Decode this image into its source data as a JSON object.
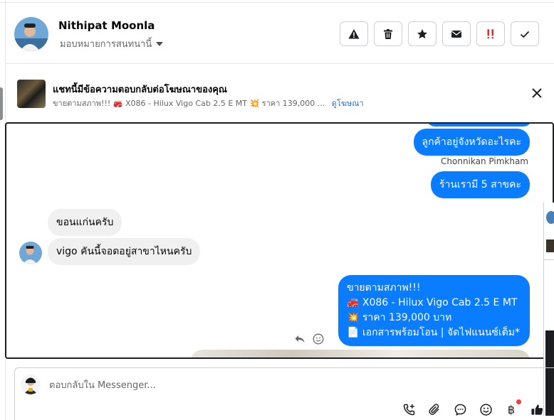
{
  "header": {
    "user_name": "Nithipat Moonla",
    "assign_label": "มอบหมายการสนทนานี้",
    "actions": [
      {
        "icon": "warning-icon",
        "name": "report-button"
      },
      {
        "icon": "trash-icon",
        "name": "delete-button"
      },
      {
        "icon": "star-icon",
        "name": "star-button"
      },
      {
        "icon": "envelope-icon",
        "name": "mark-unread-button"
      },
      {
        "icon": "follow-up-icon",
        "name": "follow-up-button"
      },
      {
        "icon": "checkmark-icon",
        "name": "mark-done-button"
      }
    ]
  },
  "ad_banner": {
    "title": "แชทนี้มีข้อความตอบกลับต่อโฆษณาของคุณ",
    "subtitle": "ขายตามสภาพ!!! 🚒 X086 - Hilux Vigo Cab 2.5 E MT 💥 ราคา 139,000 ...",
    "link": "ดูโฆษณา"
  },
  "messages": [
    {
      "direction": "out",
      "text": "ลูกค้าอยู่จังหวัดอะไรคะ",
      "sender": "Chonnikan Pimkham"
    },
    {
      "direction": "out",
      "text": "ร้านเรามี 5 สาขคะ"
    },
    {
      "direction": "in",
      "text": "ขอนแก่นครับ"
    },
    {
      "direction": "in",
      "text": "vigo คันนี้จอดอยู่สาขาไหนครับ"
    },
    {
      "direction": "out",
      "lines": [
        "ขายตามสภาพ!!!",
        "🚒 X086 - Hilux Vigo Cab 2.5 E MT",
        "💥 ราคา 139,000 บาท",
        "📄 เอกสารพร้อมโอน | จัดไฟแนนซ์เต็ม*"
      ]
    }
  ],
  "composer": {
    "placeholder": "ตอบกลับใน Messenger...",
    "tools": [
      "call-icon",
      "paperclip-icon",
      "saved-reply-icon",
      "emoji-icon",
      "baht-icon",
      "thumbs-up-icon"
    ],
    "baht_symbol": "฿"
  },
  "colors": {
    "outgoing_bubble": "#0a7cff",
    "incoming_bubble": "#f0f0f0",
    "link": "#216fdb",
    "alert_red": "#e02424"
  }
}
